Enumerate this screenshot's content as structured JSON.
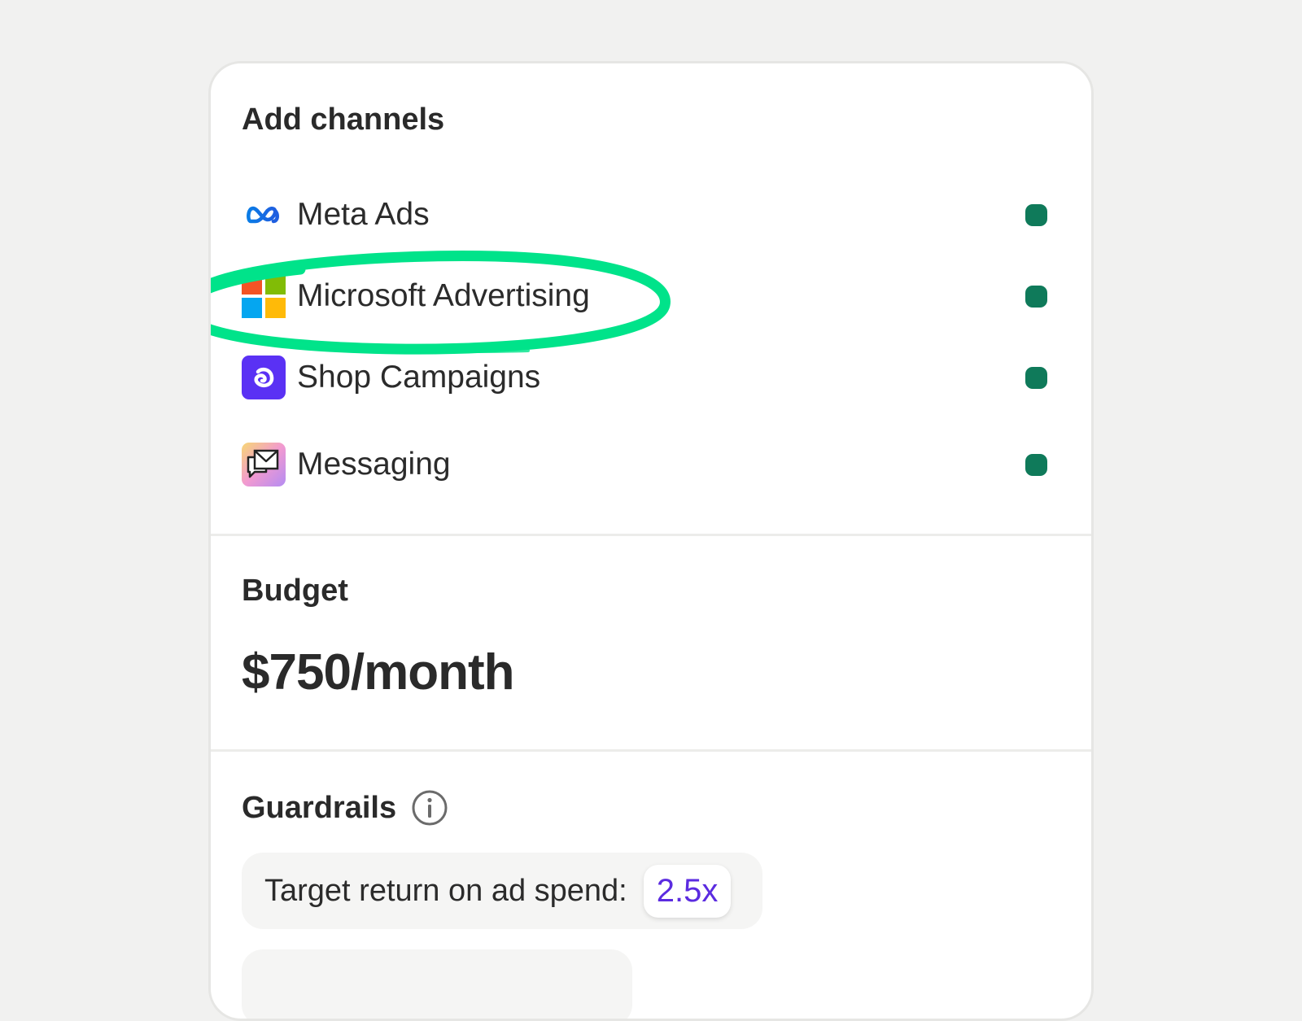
{
  "channels_section": {
    "title": "Add channels",
    "items": [
      {
        "label": "Meta Ads",
        "icon": "meta-icon",
        "status_color": "#0f7a5a"
      },
      {
        "label": "Microsoft Advertising",
        "icon": "microsoft-icon",
        "status_color": "#0f7a5a",
        "highlighted": true
      },
      {
        "label": "Shop Campaigns",
        "icon": "shop-icon",
        "status_color": "#0f7a5a"
      },
      {
        "label": "Messaging",
        "icon": "messaging-icon",
        "status_color": "#0f7a5a"
      }
    ],
    "highlight_color": "#00e38a"
  },
  "budget_section": {
    "title": "Budget",
    "value": "$750/month"
  },
  "guardrails_section": {
    "title": "Guardrails",
    "info_icon": "info-icon",
    "items": [
      {
        "label": "Target return on ad spend:",
        "value": "2.5x"
      },
      {
        "label": "",
        "value": ""
      }
    ],
    "value_color": "#5b2be0"
  },
  "colors": {
    "background": "#f1f1f0",
    "card": "#ffffff",
    "status_dot": "#0f7a5a",
    "accent_purple": "#5b2be0",
    "highlight_green": "#00e38a"
  }
}
